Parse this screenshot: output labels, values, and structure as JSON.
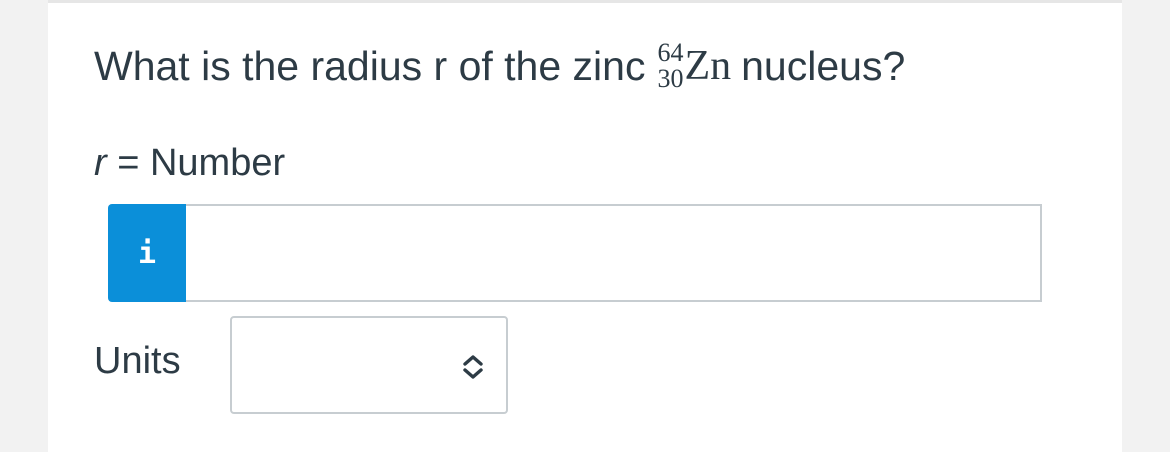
{
  "question": {
    "text_before": "What is the radius r of the zinc",
    "nuclide": {
      "mass_number": "64",
      "atomic_number": "30",
      "symbol": "Zn"
    },
    "text_after": "nucleus?"
  },
  "answer": {
    "variable": "r",
    "equals_label": "= Number",
    "info_glyph": "i",
    "info_icon": "info-icon",
    "value": "",
    "placeholder": ""
  },
  "units": {
    "label": "Units",
    "selected": "",
    "icon": "updown-chevron-icon"
  },
  "colors": {
    "accent": "#0b8fd9",
    "text": "#2d3b45",
    "border": "#c7cdd1",
    "background": "#f2f2f2",
    "card": "#ffffff"
  }
}
